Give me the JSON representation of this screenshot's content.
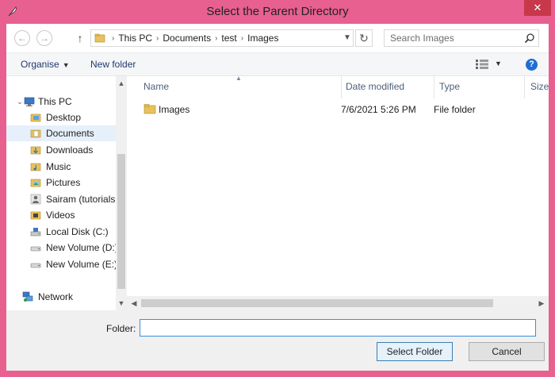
{
  "window": {
    "title": "Select the Parent Directory",
    "close_glyph": "✕"
  },
  "address": {
    "crumbs": [
      "This PC",
      "Documents",
      "test",
      "Images"
    ],
    "search_placeholder": "Search Images"
  },
  "toolbar": {
    "organise_label": "Organise",
    "new_folder_label": "New folder"
  },
  "nav": {
    "items": [
      {
        "label": "This PC",
        "icon": "computer-icon"
      },
      {
        "label": "Desktop",
        "icon": "folder-icon"
      },
      {
        "label": "Documents",
        "icon": "folder-icon",
        "selected": true
      },
      {
        "label": "Downloads",
        "icon": "folder-icon"
      },
      {
        "label": "Music",
        "icon": "folder-icon"
      },
      {
        "label": "Pictures",
        "icon": "folder-icon"
      },
      {
        "label": "Sairam (tutorialsp",
        "icon": "user-icon"
      },
      {
        "label": "Videos",
        "icon": "folder-icon"
      },
      {
        "label": "Local Disk (C:)",
        "icon": "drive-icon"
      },
      {
        "label": "New Volume (D:)",
        "icon": "drive-icon"
      },
      {
        "label": "New Volume (E:)",
        "icon": "drive-icon"
      },
      {
        "label": "Network",
        "icon": "network-icon"
      }
    ]
  },
  "files": {
    "columns": [
      "Name",
      "Date modified",
      "Type",
      "Size"
    ],
    "rows": [
      {
        "name": "Images",
        "date": "7/6/2021 5:26 PM",
        "type": "File folder",
        "size": ""
      }
    ]
  },
  "footer": {
    "folder_label": "Folder:",
    "folder_value": "",
    "select_label": "Select Folder",
    "cancel_label": "Cancel"
  },
  "colors": {
    "frame": "#e7608f",
    "close": "#c7384a",
    "accent": "#1f6fd1"
  }
}
